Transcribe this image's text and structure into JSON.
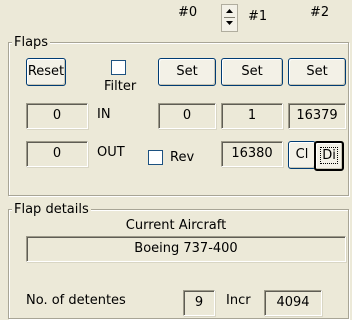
{
  "header": {
    "col0_label": "#0",
    "col1_label": "#1",
    "col2_label": "#2"
  },
  "flaps": {
    "group_label": "Flaps",
    "reset_label": "Reset",
    "filter_label": "Filter",
    "filter_checked": false,
    "set_labels": [
      "Set",
      "Set",
      "Set"
    ],
    "in_label": "IN",
    "out_label": "OUT",
    "rev_label": "Rev",
    "rev_checked": false,
    "in_left_value": "0",
    "out_left_value": "0",
    "in_values": [
      "0",
      "1",
      "16379"
    ],
    "out_value": "16380",
    "cl_label": "Cl",
    "di_label": "Di"
  },
  "details": {
    "group_label": "Flap details",
    "current_aircraft_label": "Current Aircraft",
    "aircraft_name": "Boeing 737-400",
    "detentes_label": "No. of detentes",
    "detentes_value": "9",
    "incr_label": "Incr",
    "incr_value": "4094"
  }
}
